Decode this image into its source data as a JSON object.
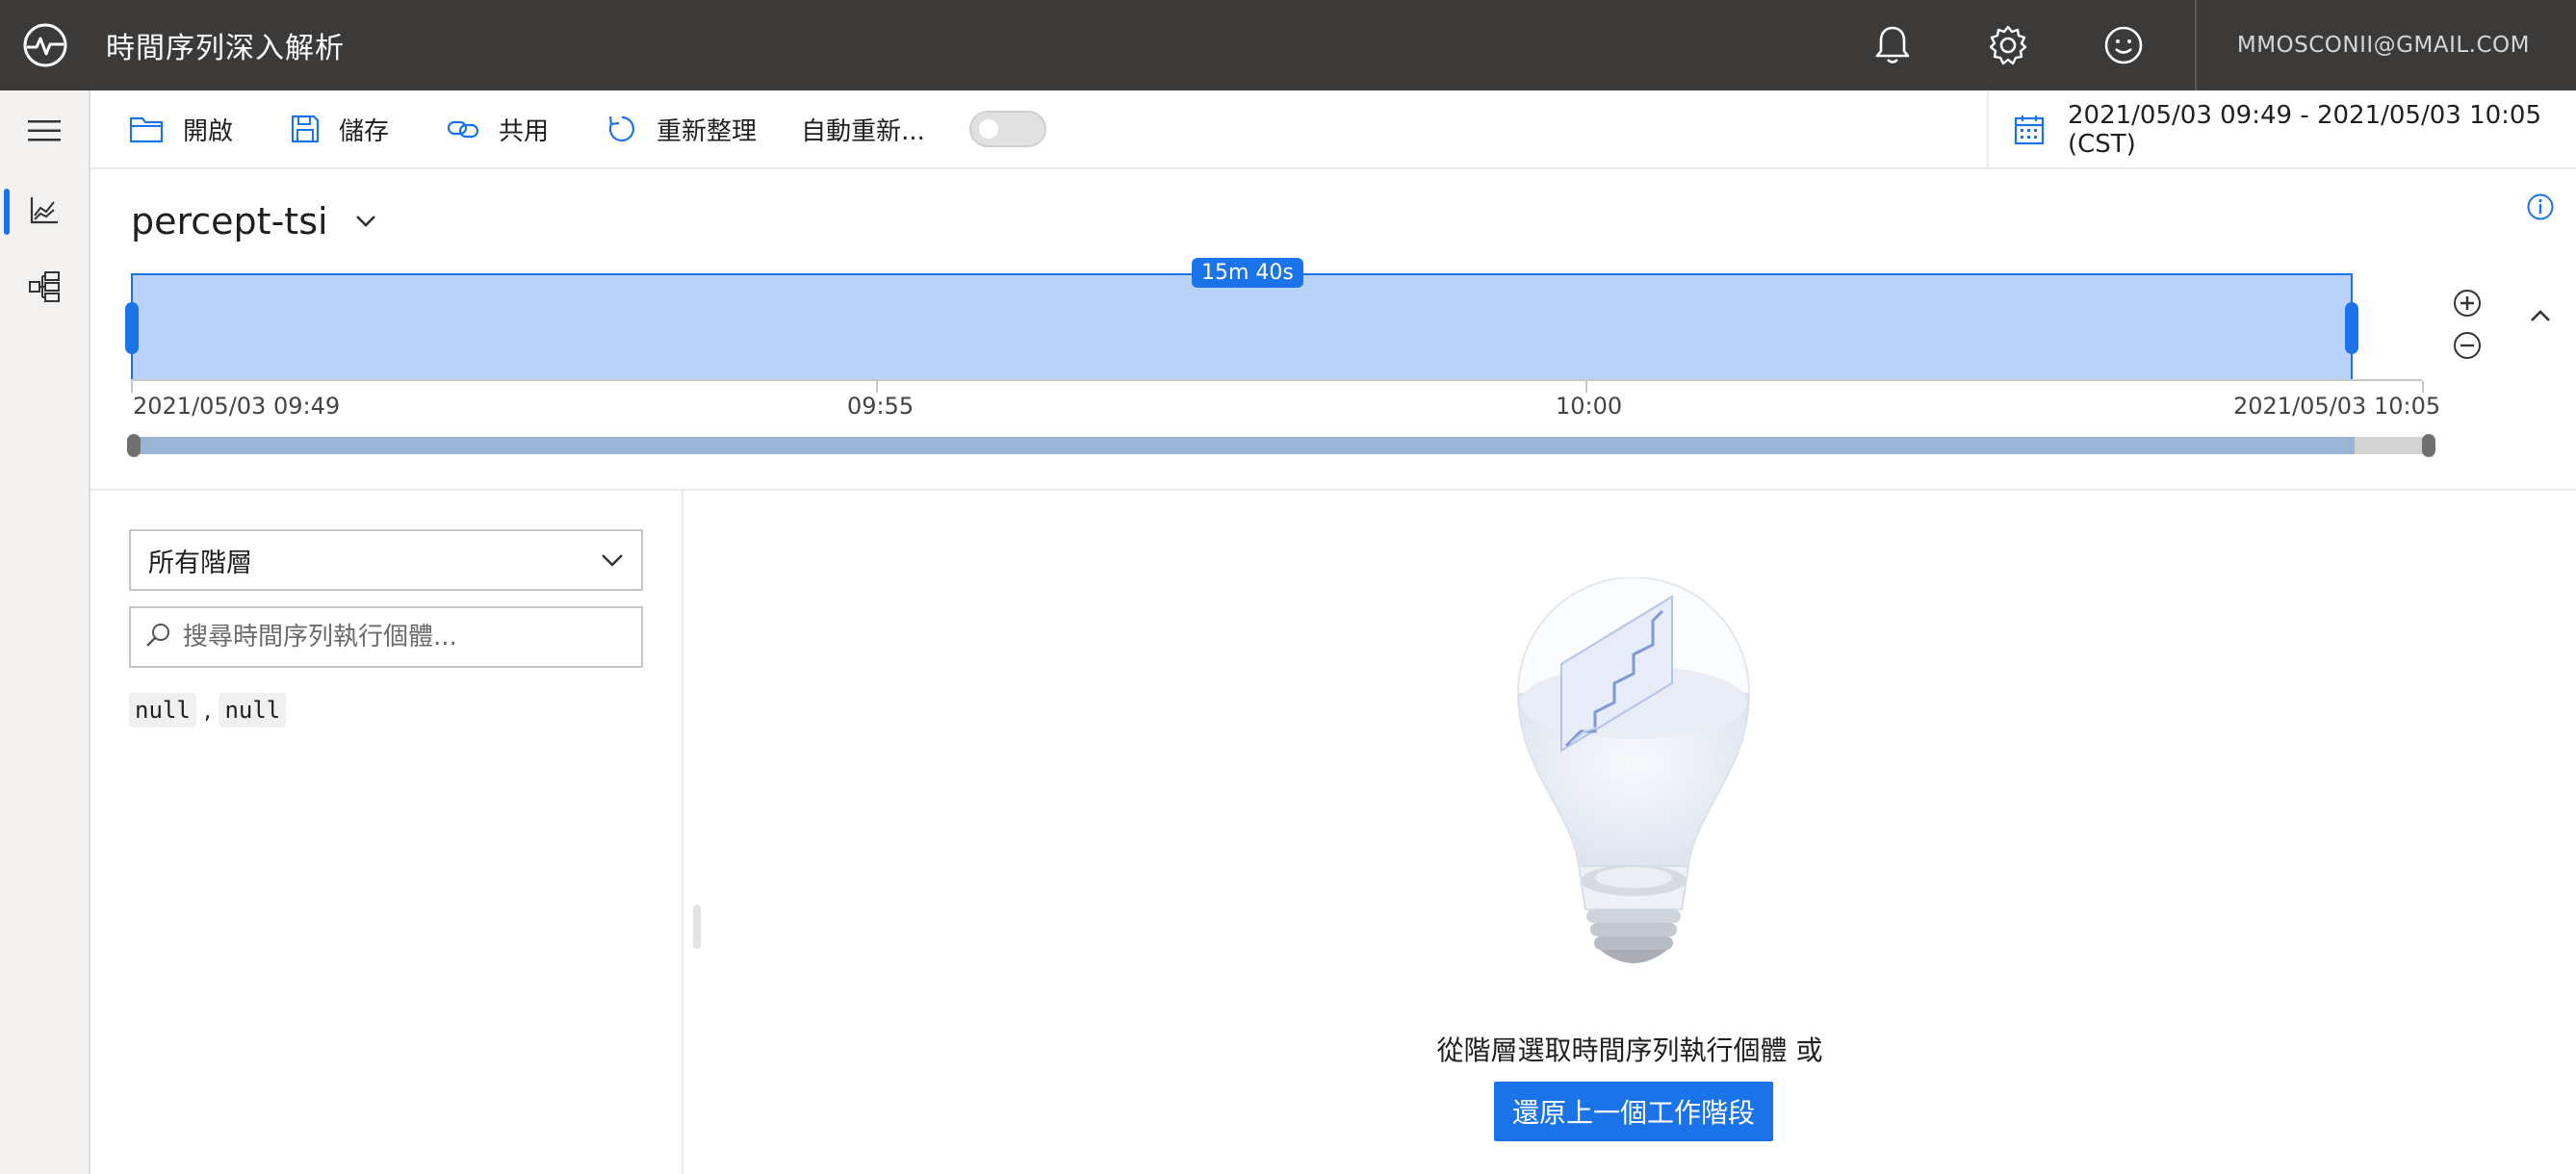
{
  "header": {
    "app_title": "時間序列深入解析",
    "user_email": "MMOSCONII@GMAIL.COM",
    "icons": [
      "notification-bell-icon",
      "settings-gear-icon",
      "feedback-smiley-icon"
    ]
  },
  "toolbar": {
    "open_label": "開啟",
    "save_label": "儲存",
    "share_label": "共用",
    "refresh_label": "重新整理",
    "auto_refresh_label": "自動重新...",
    "auto_refresh_on": false,
    "time_range": "2021/05/03 09:49 - 2021/05/03 10:05 (CST)"
  },
  "environment": {
    "name": "percept-tsi",
    "brush_duration": "15m 40s",
    "ticks": [
      "2021/05/03 09:49",
      "09:55",
      "10:00",
      "2021/05/03 10:05"
    ]
  },
  "hierarchy": {
    "selected": "所有階層",
    "search_placeholder": "搜尋時間序列執行個體...",
    "instances": [
      "null",
      "null"
    ]
  },
  "empty_state": {
    "message": "從階層選取時間序列執行個體 或",
    "restore_button": "還原上一個工作階段"
  },
  "colors": {
    "accent": "#1a73e8",
    "header_bg": "#3b3a39",
    "brush_fill": "#b8d3f7"
  }
}
